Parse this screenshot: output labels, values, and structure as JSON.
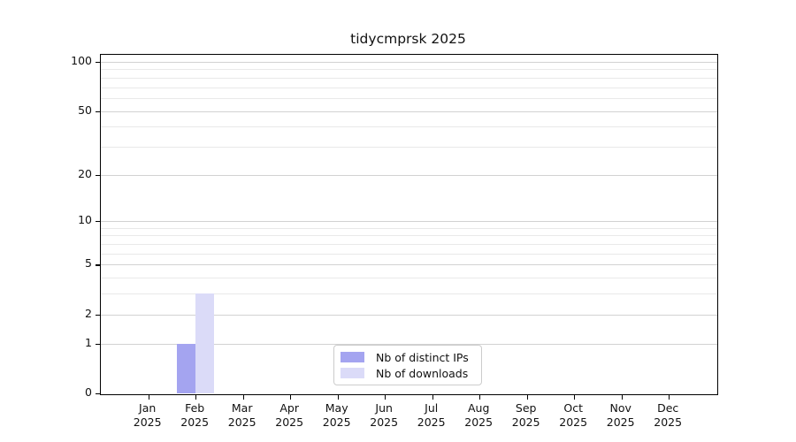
{
  "title": "tidycmprsk 2025",
  "chart_data": {
    "type": "bar",
    "title": "tidycmprsk 2025",
    "categories": [
      "Jan",
      "Feb",
      "Mar",
      "Apr",
      "May",
      "Jun",
      "Jul",
      "Aug",
      "Sep",
      "Oct",
      "Nov",
      "Dec"
    ],
    "year": "2025",
    "series": [
      {
        "name": "Nb of distinct IPs",
        "color": "#a4a4f0",
        "values": [
          0,
          1,
          0,
          0,
          0,
          0,
          0,
          0,
          0,
          0,
          0,
          0
        ]
      },
      {
        "name": "Nb of downloads",
        "color": "#dbdbf8",
        "values": [
          0,
          3,
          0,
          0,
          0,
          0,
          0,
          0,
          0,
          0,
          0,
          0
        ]
      }
    ],
    "yscale": "log1p",
    "yticks": [
      0,
      1,
      2,
      5,
      10,
      20,
      50,
      100
    ],
    "minor_yticks": [
      3,
      4,
      6,
      7,
      8,
      9,
      30,
      40,
      60,
      70,
      80,
      90
    ],
    "ylim": [
      0,
      110
    ],
    "grid": "horizontal",
    "legend_position": "lower-center-inside",
    "colors": {
      "spine": "#000000",
      "major_grid": "#d2d2d2",
      "minor_grid": "#e9e9e9",
      "text": "#111111",
      "legend_border": "#cccccc"
    }
  },
  "legend": {
    "items": [
      {
        "label": "Nb of distinct IPs",
        "color": "#a4a4f0"
      },
      {
        "label": "Nb of downloads",
        "color": "#dbdbf8"
      }
    ]
  }
}
